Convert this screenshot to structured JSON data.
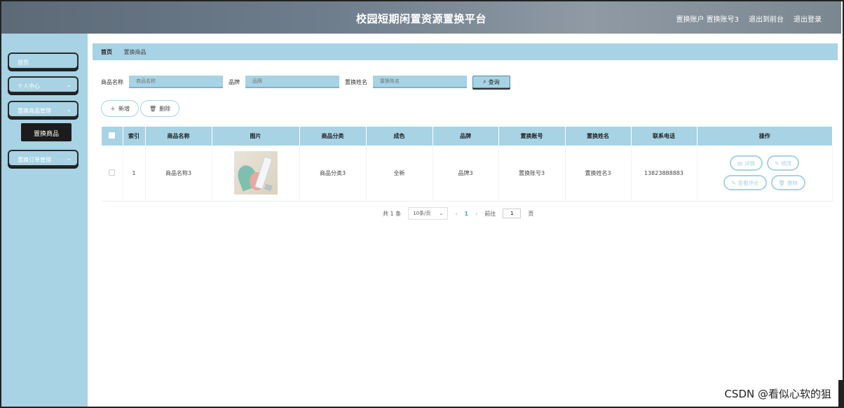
{
  "header": {
    "title": "校园短期闲置资源置换平台",
    "account": "置换账户 置换账号3",
    "back_front": "退出到前台",
    "logout": "退出登录"
  },
  "sidebar": {
    "items": [
      {
        "label": "首页"
      },
      {
        "label": "个人中心"
      },
      {
        "label": "置换商品管理"
      },
      {
        "label": "置换订单管理"
      }
    ],
    "active_sub": "置换商品"
  },
  "breadcrumb": {
    "home": "首页",
    "current": "置换商品"
  },
  "search": {
    "name_label": "商品名称",
    "name_placeholder": "商品名称",
    "brand_label": "品牌",
    "brand_placeholder": "品牌",
    "owner_label": "置换姓名",
    "owner_placeholder": "置换姓名",
    "query_label": "查询"
  },
  "actions": {
    "add_label": "新增",
    "delete_label": "删除"
  },
  "table": {
    "columns": [
      "索引",
      "商品名称",
      "图片",
      "商品分类",
      "成色",
      "品牌",
      "置换账号",
      "置换姓名",
      "联系电话",
      "操作"
    ],
    "rows": [
      {
        "index": "1",
        "name": "商品名称3",
        "category": "商品分类3",
        "condition": "全新",
        "brand": "品牌3",
        "account": "置换账号3",
        "owner": "置换姓名3",
        "phone": "13823888883",
        "ops": {
          "detail": "详情",
          "edit": "修改",
          "review": "查看评论",
          "delete": "删除"
        }
      }
    ]
  },
  "pager": {
    "total": "共 1 条",
    "page_size": "10条/页",
    "current_page": "1",
    "goto_label": "前往",
    "goto_value": "1",
    "page_unit": "页"
  },
  "watermark": "CSDN @看似心软的狙",
  "colors": {
    "accent": "#a7d3e4",
    "header_bg": "#6f7e8c"
  }
}
